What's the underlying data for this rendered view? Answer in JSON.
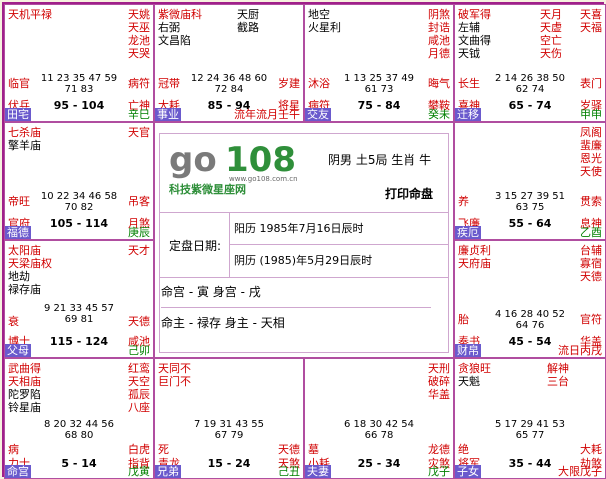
{
  "center": {
    "logo_main": "go108",
    "logo_url": "www.go108.com.cn",
    "logo_sub": "科技紫微星座网",
    "person": "阴男 土5局 生肖 牛",
    "print_label": "打印命盘",
    "date_label": "定盘日期:",
    "solar": "阳历 1985年7月16日辰时",
    "lunar": "阴历 (1985)年5月29日辰时",
    "ming_shen": "命宫 - 寅   身宫 - 戌",
    "zhu": "命主 - 禄存   身主 - 天相"
  },
  "palaces": [
    {
      "id": "p0",
      "main": [
        "天机平禄"
      ],
      "side": [
        "天姚",
        "天巫",
        "龙池",
        "天哭"
      ],
      "mid": [],
      "ages1": "11 23 35 47 59",
      "ages2": "71 83",
      "lt": "临官",
      "rt": "病符",
      "lb": "伏兵",
      "range": "95 - 104",
      "rb": "亡神",
      "name": "田宅",
      "gz": "辛巳",
      "yr": ""
    },
    {
      "id": "p1",
      "main": [
        "紫微庙科",
        "右弼",
        "文昌陷"
      ],
      "side": [],
      "mid": [
        "天厨",
        "截路"
      ],
      "ages1": "12 24 36 48 60",
      "ages2": "72 84",
      "lt": "冠带",
      "rt": "岁建",
      "lb": "大耗",
      "range": "85 - 94",
      "rb": "将星",
      "name": "事业",
      "gz": "壬午",
      "yr": "流年流月"
    },
    {
      "id": "p2",
      "main": [
        "地空",
        "火星利"
      ],
      "side": [
        "阴煞",
        "封诰",
        "咸池",
        "月德"
      ],
      "mid": [],
      "ages1": "1 13 25 37 49",
      "ages2": "61 73",
      "lt": "沐浴",
      "rt": "晦气",
      "lb": "病符",
      "range": "75 - 84",
      "rb": "攀鞍",
      "name": "交友",
      "gz": "癸未",
      "yr": ""
    },
    {
      "id": "p3",
      "main": [
        "破军得",
        "左辅",
        "文曲得",
        "天钺"
      ],
      "side": [
        "天月",
        "天虚",
        "空亡",
        "天伤"
      ],
      "mid": [],
      "ages1": "2 14 26 38 50",
      "ages2": "62 74",
      "lt": "长生",
      "rt": "丧门",
      "lb": "喜神",
      "range": "65 - 74",
      "rb": "岁驿",
      "name": "迁移",
      "gz": "甲申",
      "yr": "",
      "side2": [
        "天喜",
        "天福",
        "",
        "表门"
      ]
    },
    {
      "id": "p4",
      "main": [
        "七杀庙",
        "擎羊庙"
      ],
      "side": [
        "天官"
      ],
      "mid": [],
      "ages1": "10 22 34 46 58",
      "ages2": "70 82",
      "lt": "帝旺",
      "rt": "吊客",
      "lb": "官府",
      "range": "105 - 114",
      "rb": "月煞",
      "name": "福德",
      "gz": "庚辰",
      "yr": ""
    },
    {
      "id": "p5",
      "main": [],
      "side": [
        "凤阁",
        "蜚廉",
        "恩光",
        "天使"
      ],
      "mid": [],
      "ages1": "3 15 27 39 51",
      "ages2": "63 75",
      "lt": "养",
      "rt": "贯索",
      "lb": "飞廉",
      "range": "55 - 64",
      "rb": "息神",
      "name": "疾厄",
      "gz": "乙酉",
      "yr": ""
    },
    {
      "id": "p6",
      "main": [
        "太阳庙",
        "天梁庙权",
        "地劫",
        "禄存庙"
      ],
      "side": [
        "天才"
      ],
      "mid": [],
      "ages1": "9 21 33 45 57",
      "ages2": "69 81",
      "lt": "衰",
      "rt": "天德",
      "lb": "博士",
      "range": "115 - 124",
      "rb": "咸池",
      "name": "父母",
      "gz": "己卯",
      "yr": ""
    },
    {
      "id": "p7",
      "main": [
        "廉贞利",
        "天府庙"
      ],
      "side": [
        "台辅",
        "寡宿",
        "天德"
      ],
      "mid": [],
      "ages1": "4 16 28 40 52",
      "ages2": "64 76",
      "lt": "胎",
      "rt": "官符",
      "lb": "奏书",
      "range": "45 - 54",
      "rb": "华盖",
      "name": "财帛",
      "gz": "丙戌",
      "yr": "流日"
    },
    {
      "id": "p8",
      "main": [
        "武曲得",
        "天相庙",
        "陀罗陷",
        "铃星庙"
      ],
      "side": [
        "红鸾",
        "天空",
        "孤辰",
        "八座"
      ],
      "mid": [],
      "ages1": "8 20 32 44 56",
      "ages2": "68 80",
      "lt": "病",
      "rt": "白虎",
      "lb": "力士",
      "range": "5 - 14",
      "rb": "指背",
      "name": "命宫",
      "gz": "戊寅",
      "yr": ""
    },
    {
      "id": "p9",
      "main": [
        "天同不",
        "巨门不"
      ],
      "side": [],
      "mid": [],
      "ages1": "7 19 31 43 55",
      "ages2": "67 79",
      "lt": "死",
      "rt": "天德",
      "lb": "青龙",
      "range": "15 - 24",
      "rb": "天煞",
      "name": "兄弟",
      "gz": "己丑",
      "yr": ""
    },
    {
      "id": "p10",
      "main": [
        "天刑",
        "破碎",
        "华盖"
      ],
      "side": [],
      "mid": [],
      "ages1": "6 18 30 42 54",
      "ages2": "66 78",
      "lt": "墓",
      "rt": "龙德",
      "lb": "小耗",
      "range": "25 - 34",
      "rb": "灾煞",
      "name": "夫妻",
      "gz": "戊子",
      "yr": "大限"
    },
    {
      "id": "p11",
      "main": [
        "贪狼旺",
        "天魁"
      ],
      "side": [
        "解神",
        "三台"
      ],
      "mid": [],
      "ages1": "5 17 29 41 53",
      "ages2": "65 77",
      "lt": "绝",
      "rt": "大耗",
      "lb": "将军",
      "range": "35 - 44",
      "rb": "劫煞",
      "name": "子女",
      "gz": "丁亥",
      "yr": "小限",
      "side2": [
        "天寿",
        "天贵"
      ]
    },
    {
      "id": "p12",
      "main": [
        "太阴庙忌",
        "天马"
      ],
      "side": [
        "天寿",
        "天贵"
      ],
      "mid": [],
      "ages1": "5 17 29 41 53",
      "ages2": "65 77",
      "lt": "绝",
      "rt": "小耗",
      "lb": "将军",
      "range": "35 - 44",
      "rb": "劫煞",
      "name": "子女",
      "gz": "丁亥",
      "yr": "小限"
    }
  ]
}
